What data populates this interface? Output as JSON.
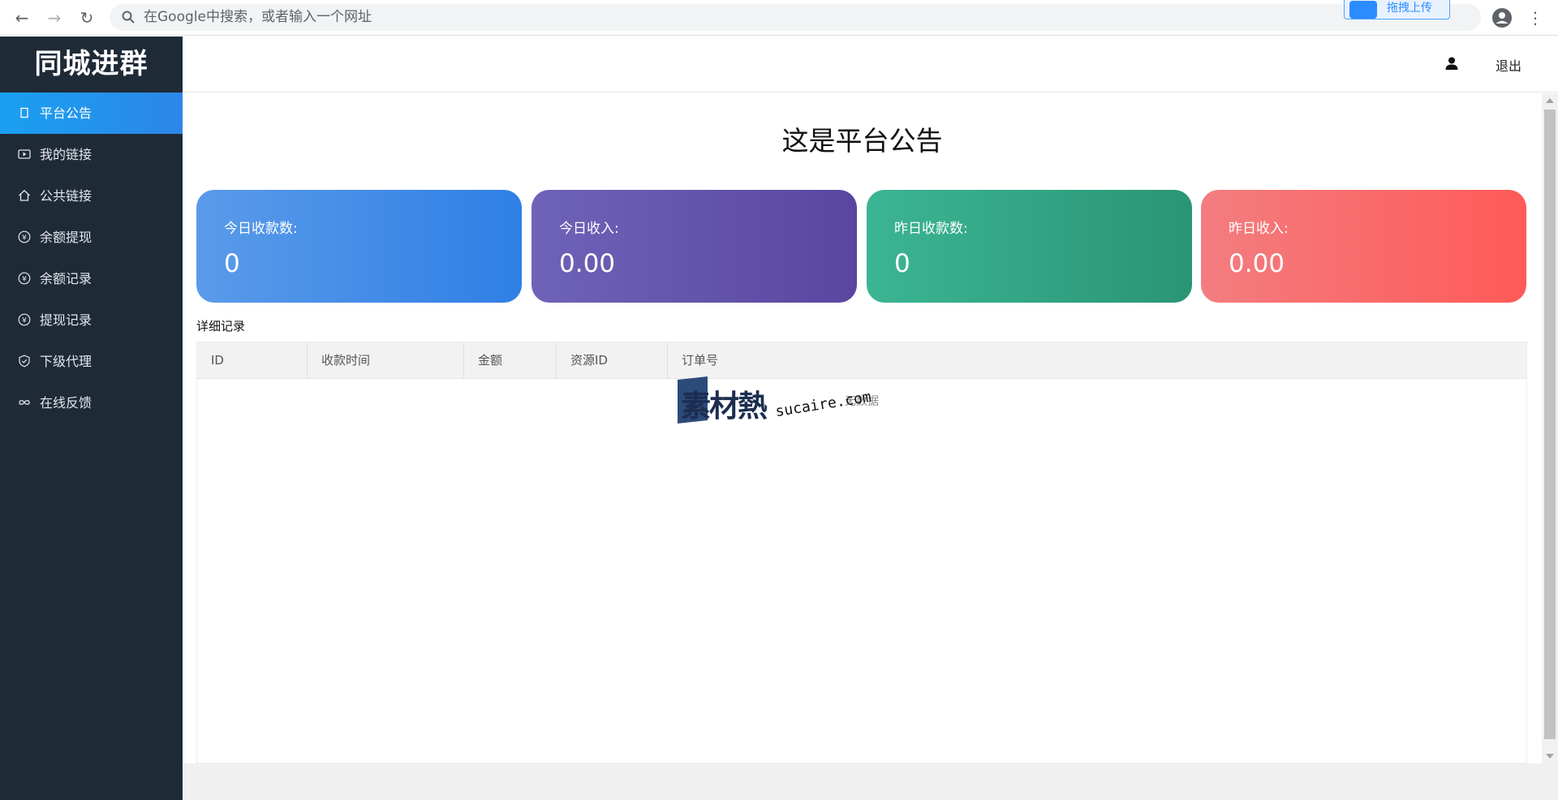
{
  "browser": {
    "omnibox_placeholder": "在Google中搜索，或者输入一个网址",
    "extension_label": "拖拽上传"
  },
  "sidebar": {
    "logo": "同城进群",
    "items": [
      {
        "label": "平台公告",
        "icon": "square-icon",
        "active": true
      },
      {
        "label": "我的链接",
        "icon": "video-icon",
        "active": false
      },
      {
        "label": "公共链接",
        "icon": "home-icon",
        "active": false
      },
      {
        "label": "余额提现",
        "icon": "yen-circle-icon",
        "active": false
      },
      {
        "label": "余额记录",
        "icon": "yen-circle-icon",
        "active": false
      },
      {
        "label": "提现记录",
        "icon": "yen-circle-icon",
        "active": false
      },
      {
        "label": "下级代理",
        "icon": "shield-check-icon",
        "active": false
      },
      {
        "label": "在线反馈",
        "icon": "infinity-icon",
        "active": false
      }
    ]
  },
  "header": {
    "logout_label": "退出"
  },
  "main": {
    "notice_title": "这是平台公告",
    "cards": [
      {
        "label": "今日收款数:",
        "value": "0"
      },
      {
        "label": "今日收入:",
        "value": "0.00"
      },
      {
        "label": "昨日收款数:",
        "value": "0"
      },
      {
        "label": "昨日收入:",
        "value": "0.00"
      }
    ],
    "section_label": "详细记录",
    "table": {
      "columns": [
        "ID",
        "收款时间",
        "金额",
        "资源ID",
        "订单号"
      ],
      "empty_text": "无数据"
    }
  },
  "watermark": {
    "cn": "素材熱",
    "en": "sucaire.com"
  },
  "colors": {
    "sidebar_bg": "#1f2a37",
    "active_item": "#1aa0f0",
    "card_blue": "#2f7fe6",
    "card_purple": "#5a46a0",
    "card_green": "#2a9575",
    "card_red": "#ff5a57"
  }
}
